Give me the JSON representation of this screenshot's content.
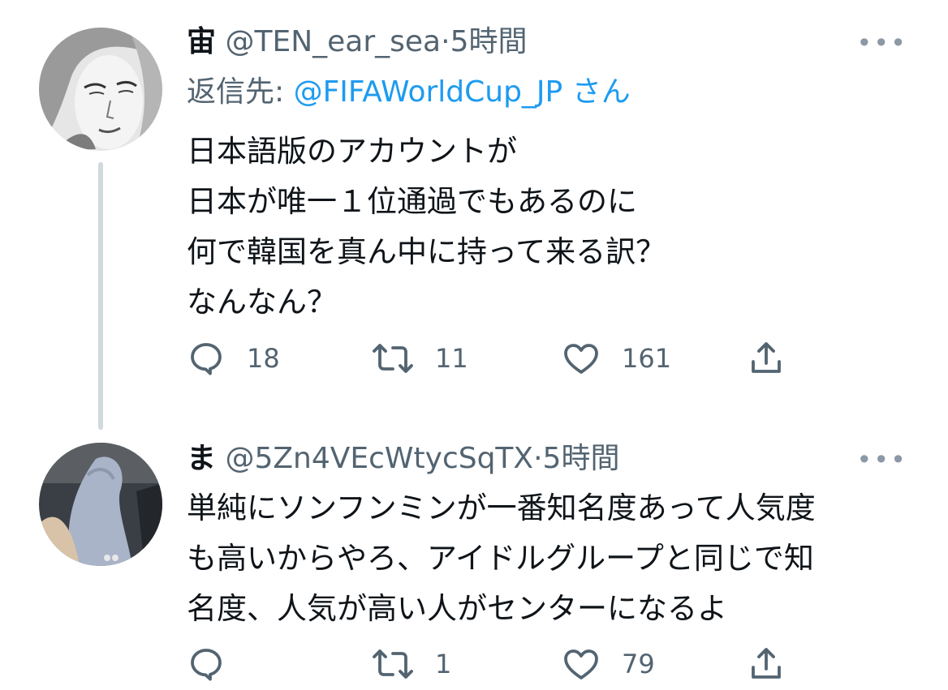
{
  "tweets": [
    {
      "name": "宙",
      "handle": "@TEN_ear_sea",
      "separator": "·",
      "time": "5時間",
      "reply_prefix": "返信先: ",
      "reply_mention": "@FIFAWorldCup_JP",
      "reply_suffix": " さん",
      "lines": [
        "日本語版のアカウントが",
        "日本が唯一１位通過でもあるのに",
        "何で韓国を真ん中に持って来る訳？",
        "なんなん？"
      ],
      "replies": "18",
      "retweets": "11",
      "likes": "161"
    },
    {
      "name": "ま",
      "handle": "@5Zn4VEcWtycSqTX",
      "separator": "·",
      "time": "5時間",
      "lines": [
        "単純にソンフンミンが一番知名度あって人気度",
        "も高いからやろ、アイドルグループと同じで知",
        "名度、人気が高い人がセンターになるよ"
      ],
      "replies": "",
      "retweets": "1",
      "likes": "79"
    }
  ],
  "more_label": "•••",
  "icons": [
    "reply-icon",
    "retweet-icon",
    "like-icon",
    "share-icon",
    "more-icon"
  ],
  "colors": {
    "mention": "#1d9bf0",
    "secondary": "#536471",
    "thread_line": "#cfd9de"
  }
}
